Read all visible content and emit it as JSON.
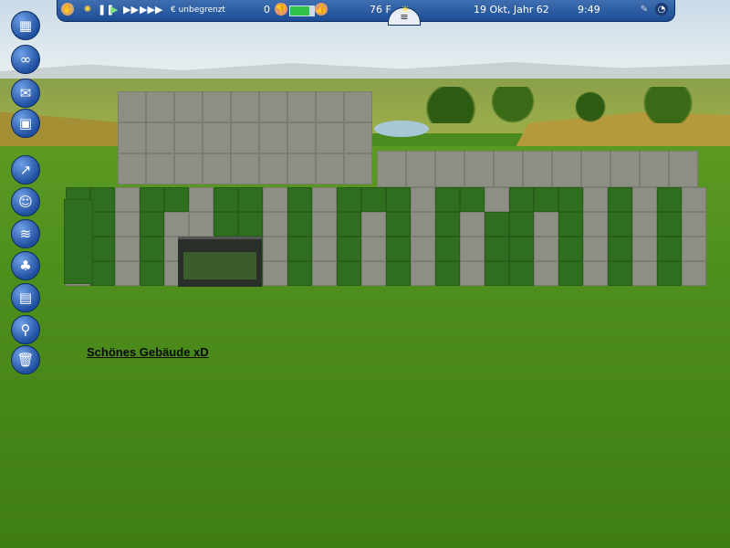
{
  "toolbar": {
    "money": "€ unbegrenzt",
    "guests": "0",
    "park_rating_fraction": 0.8,
    "temperature": "76 F",
    "date": "19 Okt, Jahr 62",
    "time": "9:49",
    "pause_glyph": "❚❚",
    "play_glyph": "▶",
    "fast_glyph": "▶▶",
    "fastest_glyph": "▶▶▶",
    "menu_glyph": "≡",
    "sun_glyph": "☀"
  },
  "sidebar": {
    "items": [
      {
        "name": "map-icon",
        "glyph": "▦"
      },
      {
        "name": "binoculars-icon",
        "glyph": "∞"
      },
      {
        "name": "tickets-icon",
        "glyph": "✉"
      },
      {
        "name": "scenery-flag-icon",
        "glyph": "▣"
      },
      {
        "name": "finance-chart-icon",
        "glyph": "↗"
      },
      {
        "name": "staff-icon",
        "glyph": "☺"
      },
      {
        "name": "ride-tracks-icon",
        "glyph": "≋"
      },
      {
        "name": "landscape-tree-icon",
        "glyph": "♣"
      },
      {
        "name": "path-icon",
        "glyph": "▤"
      },
      {
        "name": "shovel-icon",
        "glyph": "⚲"
      },
      {
        "name": "trash-bin-icon",
        "glyph": "🗑"
      }
    ]
  },
  "sign": {
    "text": "Schönes Gebäude xD"
  },
  "colors": {
    "stone": "#8e8f84",
    "hedge": "#2f6e1e",
    "toolbar": "#2a5aa0"
  }
}
